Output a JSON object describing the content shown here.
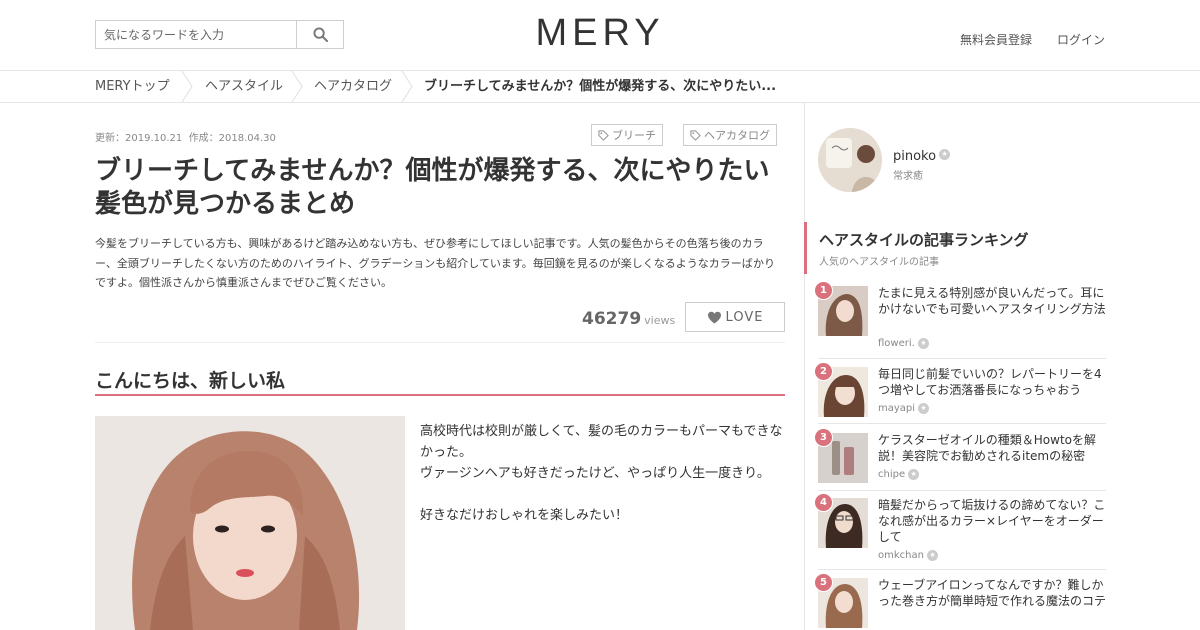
{
  "header": {
    "logo": "MERY",
    "search_placeholder": "気になるワードを入力",
    "register": "無料会員登録",
    "login": "ログイン"
  },
  "breadcrumb": [
    "MERYトップ",
    "ヘアスタイル",
    "ヘアカタログ",
    "ブリーチしてみませんか？個性が爆発する、次にやりたい..."
  ],
  "article": {
    "updated": "更新：2019.10.21",
    "created": "作成：2018.04.30",
    "tags": [
      "ブリーチ",
      "ヘアカタログ"
    ],
    "title": "ブリーチしてみませんか？個性が爆発する、次にやりたい髪色が見つかるまとめ",
    "description": "今髪をブリーチしている方も、興味があるけど踏み込めない方も、ぜひ参考にしてほしい記事です。人気の髪色からその色落ち後のカラー、全頭ブリーチしたくない方のためのハイライト、グラデーションも紹介しています。毎回鏡を見るのが楽しくなるようなカラーばかりですよ。個性派さんから慎重派さんまでぜひご覧ください。",
    "views": "46279",
    "views_label": "views",
    "love_label": "LOVE",
    "section_heading": "こんにちは、新しい私",
    "body_lines": [
      "高校時代は校則が厳しくて、髪の毛のカラーもパーマもできなかった。",
      "ヴァージンヘアも好きだったけど、やっぱり人生一度きり。",
      "",
      "好きなだけおしゃれを楽しみたい！"
    ]
  },
  "author": {
    "name": "pinoko",
    "subtitle": "常求癒"
  },
  "ranking": {
    "title": "ヘアスタイルの記事ランキング",
    "subtitle": "人気のヘアスタイルの記事",
    "items": [
      {
        "rank": "1",
        "title": "たまに見える特別感が良いんだって。耳にかけないでも可愛いヘアスタイリング方法",
        "author": "floweri."
      },
      {
        "rank": "2",
        "title": "毎日同じ前髪でいいの？レパートリーを4つ増やしてお洒落番長になっちゃおう",
        "author": "mayapi"
      },
      {
        "rank": "3",
        "title": "ケラスターゼオイルの種類＆Howtoを解説！美容院でお勧めされるitemの秘密",
        "author": "chipe"
      },
      {
        "rank": "4",
        "title": "暗髪だからって垢抜けるの諦めてない？こなれ感が出るカラー×レイヤーをオーダーして",
        "author": "omkchan"
      },
      {
        "rank": "5",
        "title": "ウェーブアイロンってなんですか？難しかった巻き方が簡単時短で作れる魔法のコテ",
        "author": ""
      }
    ]
  },
  "colors": {
    "accent": "#d9727c",
    "border": "#e6e6e6",
    "text": "#333333"
  }
}
